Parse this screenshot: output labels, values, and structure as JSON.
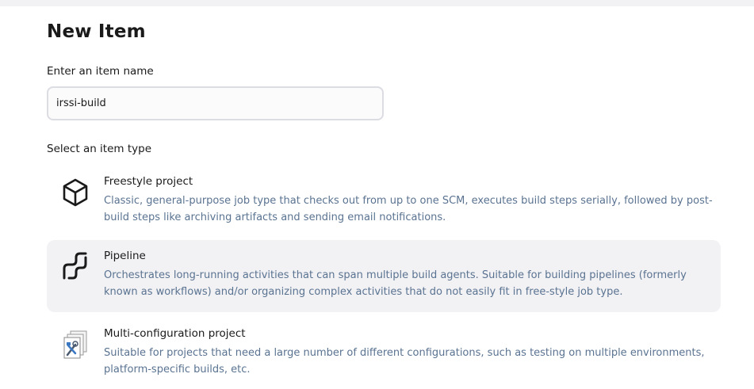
{
  "page": {
    "title": "New Item"
  },
  "name_field": {
    "label": "Enter an item name",
    "value": "irssi-build"
  },
  "item_types": {
    "label": "Select an item type",
    "selected": "Pipeline",
    "items": [
      {
        "name": "Freestyle project",
        "icon": "cube-icon",
        "description": "Classic, general-purpose job type that checks out from up to one SCM, executes build steps serially, followed by post-build steps like archiving artifacts and sending email notifications."
      },
      {
        "name": "Pipeline",
        "icon": "pipeline-icon",
        "description": "Orchestrates long-running activities that can span multiple build agents. Suitable for building pipelines (formerly known as workflows) and/or organizing complex activities that do not easily fit in free-style job type."
      },
      {
        "name": "Multi-configuration project",
        "icon": "multi-config-icon",
        "description": "Suitable for projects that need a large number of different configurations, such as testing on multiple environments, platform-specific builds, etc."
      }
    ]
  },
  "colors": {
    "selected_background": "#f2f2f5",
    "description_text": "#5a7391",
    "input_border": "#dcdce3"
  }
}
